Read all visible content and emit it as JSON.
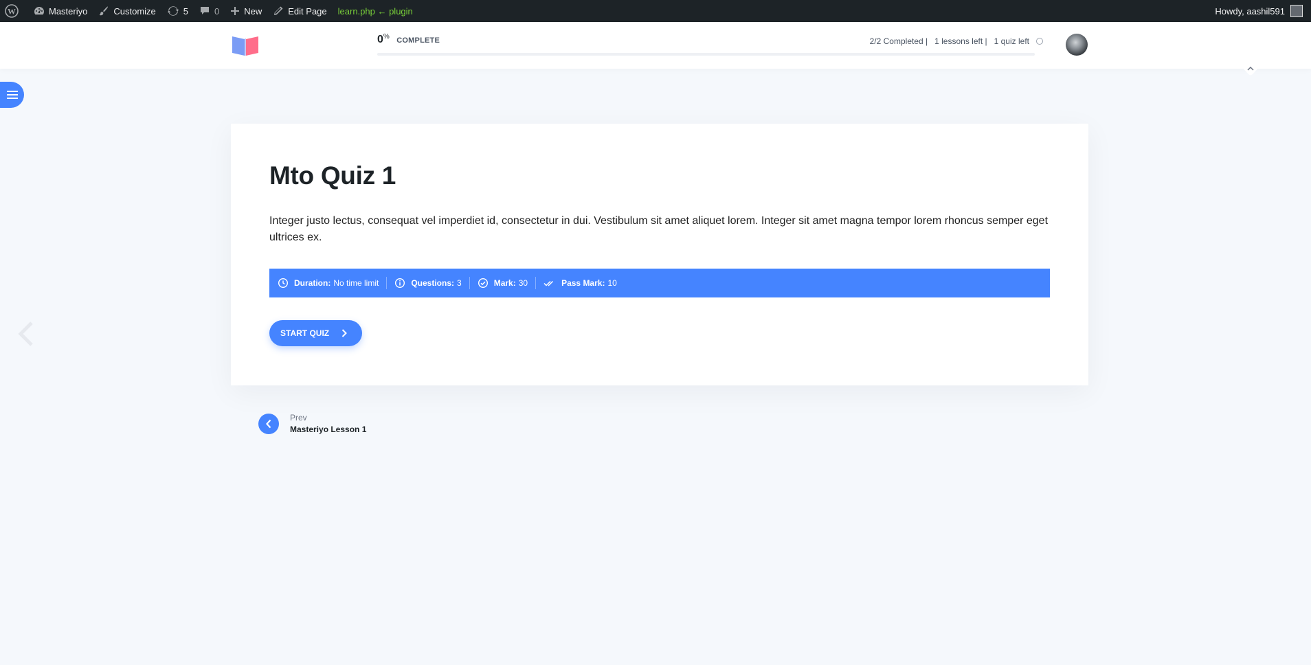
{
  "admin_bar": {
    "site_name": "Masteriyo",
    "customize": "Customize",
    "updates_count": "5",
    "comments_count": "0",
    "new_label": "New",
    "edit_page": "Edit Page",
    "template_info": "learn.php ← plugin",
    "greeting": "Howdy, aashil591"
  },
  "course_header": {
    "progress_value": "0",
    "progress_unit": "%",
    "progress_label": "COMPLETE",
    "progress_fraction": 0,
    "completed": "2/2 Completed |",
    "lessons_left": "1 lessons left |",
    "quiz_left": "1 quiz left"
  },
  "quiz": {
    "title": "Mto Quiz 1",
    "description": "Integer justo lectus, consequat vel imperdiet id, consectetur in dui. Vestibulum sit amet aliquet lorem. Integer sit amet magna tempor lorem rhoncus semper eget ultrices ex.",
    "meta": {
      "duration_label": "Duration:",
      "duration_value": "No time limit",
      "questions_label": "Questions:",
      "questions_value": "3",
      "mark_label": "Mark:",
      "mark_value": "30",
      "pass_mark_label": "Pass Mark:",
      "pass_mark_value": "10"
    },
    "start_button": "START QUIZ"
  },
  "navigation": {
    "prev_label": "Prev",
    "prev_title": "Masteriyo Lesson 1"
  },
  "colors": {
    "accent": "#4584ff",
    "admin_bar": "#1d2327",
    "background": "#f5f8fc"
  }
}
